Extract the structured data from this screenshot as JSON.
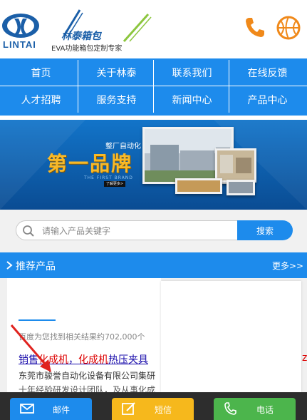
{
  "header": {
    "logo_text": "LINTAI",
    "brand_name": "林泰箱包",
    "brand_tagline": "EVA功能箱包定制专家",
    "accent_color": "#1d8bec",
    "icons": [
      "phone-icon",
      "basketball-icon"
    ]
  },
  "nav": {
    "items": [
      {
        "label": "首页"
      },
      {
        "label": "关于林泰"
      },
      {
        "label": "联系我们"
      },
      {
        "label": "在线反馈"
      },
      {
        "label": "人才招聘"
      },
      {
        "label": "服务支持"
      },
      {
        "label": "新闻中心"
      },
      {
        "label": "产品中心"
      }
    ]
  },
  "banner": {
    "subtitle": "整厂自动化",
    "title": "第一品牌",
    "english": "THE FIRST BRAND",
    "more": "了解更多>"
  },
  "search": {
    "placeholder": "请输入产品关键字",
    "button_label": "搜索"
  },
  "section": {
    "title": "推荐产品",
    "more_label": "更多>>"
  },
  "overlay_result": {
    "count_text": "百度为您找到相关结果约702,000个",
    "link_text_plain1": "销售",
    "link_text_em1": "化成机",
    "link_text_plain2": "，",
    "link_text_em2": "化成机",
    "link_text_plain3": "热压夹具",
    "snippet1": "东莞市骏誉自动化设备有限公司集研",
    "snippet2": "十年经验研发设计团队，及从事化成",
    "edge_char": "z"
  },
  "bottom_bar": {
    "email_label": "邮件",
    "sms_label": "短信",
    "call_label": "电话",
    "email_color": "#1d8bec",
    "sms_color": "#f6b81c",
    "call_color": "#4cb54c"
  }
}
